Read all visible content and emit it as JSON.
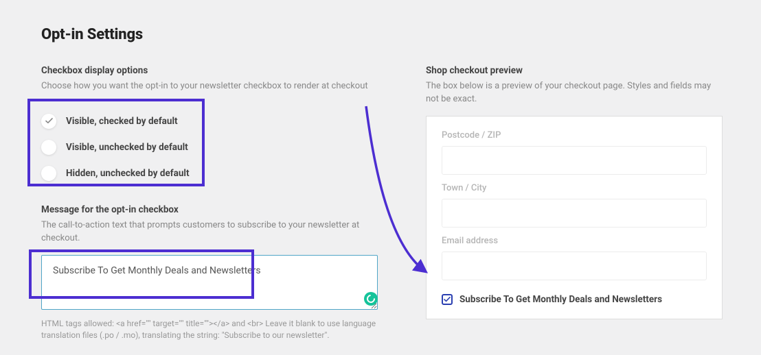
{
  "page_title": "Opt-in Settings",
  "checkbox_options": {
    "heading": "Checkbox display options",
    "subtext": "Choose how you want the opt-in to your newsletter checkbox to render at checkout",
    "options": [
      {
        "label": "Visible, checked by default",
        "selected": true
      },
      {
        "label": "Visible, unchecked by default",
        "selected": false
      },
      {
        "label": "Hidden, unchecked by default",
        "selected": false
      }
    ]
  },
  "message": {
    "heading": "Message for the opt-in checkbox",
    "subtext": "The call-to-action text that prompts customers to subscribe to your newsletter at checkout.",
    "value": "Subscribe To Get Monthly Deals and Newsletters",
    "hint": "HTML tags allowed: <a href=\"\" target=\"\" title=\"\"></a> and <br>\nLeave it blank to use language translation files (.po / .mo), translating the string: \"Subscribe to our newsletter\"."
  },
  "preview": {
    "heading": "Shop checkout preview",
    "subtext": "The box below is a preview of your checkout page. Styles and fields may not be exact.",
    "fields": [
      "Postcode / ZIP",
      "Town / City",
      "Email address"
    ],
    "subscribe_label": "Subscribe To Get Monthly Deals and Newsletters"
  },
  "colors": {
    "highlight": "#4c2ed1",
    "checkbox_border": "#2a3fb1"
  }
}
